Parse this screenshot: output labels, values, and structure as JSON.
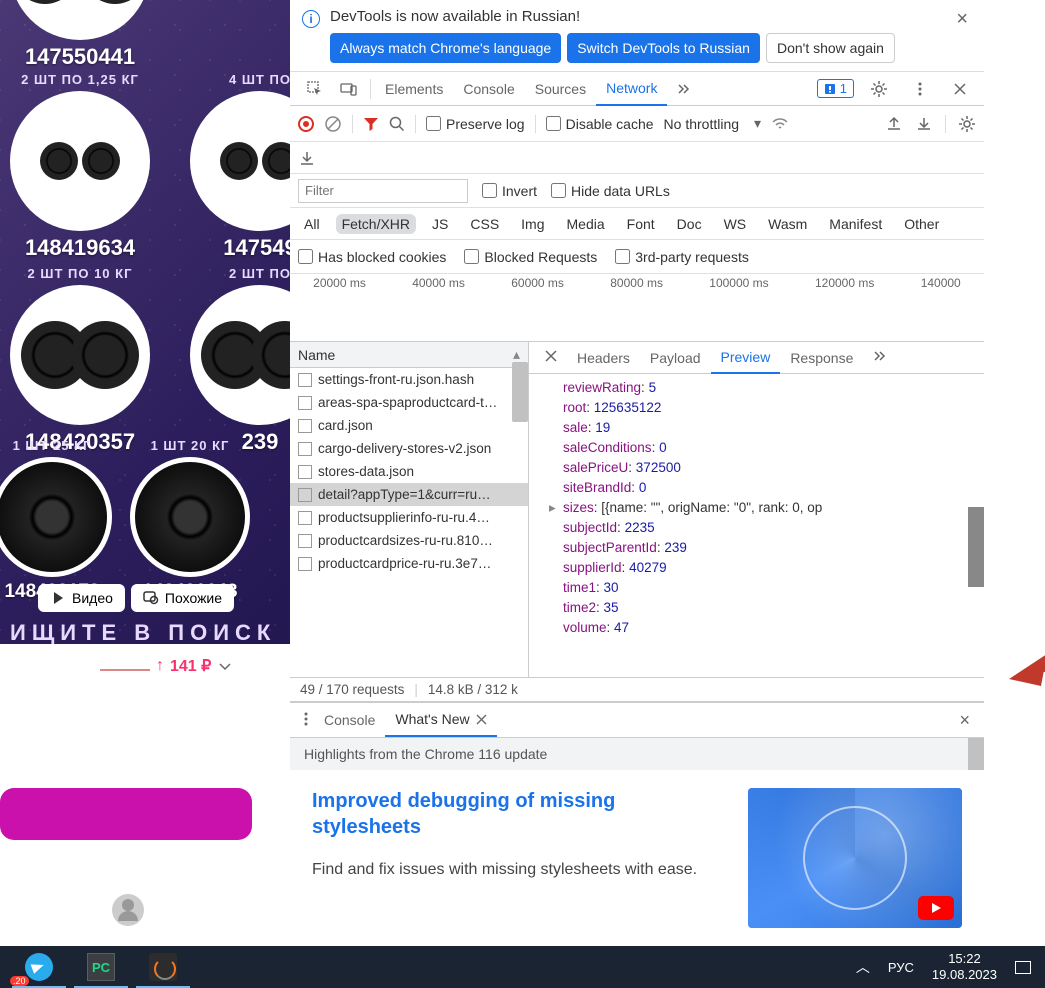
{
  "left": {
    "products": [
      {
        "arc": "",
        "num": "147550441"
      },
      {
        "arc": "2 ШТ ПО 1,25 КГ",
        "num": "148419634"
      },
      {
        "arc": "4 ШТ ПО",
        "num": "147549"
      },
      {
        "arc": "2 ШТ ПО 10 КГ",
        "num": "148420357"
      },
      {
        "arc": "2 ШТ ПО",
        "num": "239"
      },
      {
        "arc": "1 ШТ 25 КГ",
        "num": "148422178"
      },
      {
        "arc": "1 ШТ 20 КГ",
        "num": "148421643"
      }
    ],
    "video_btn": "Видео",
    "similar_btn": "Похожие",
    "search_text": "ИЩИТЕ В ПОИСК",
    "price": "141 ₽"
  },
  "infobar": {
    "text": "DevTools is now available in Russian!",
    "btn1": "Always match Chrome's language",
    "btn2": "Switch DevTools to Russian",
    "btn3": "Don't show again"
  },
  "tabs": {
    "elements": "Elements",
    "console": "Console",
    "sources": "Sources",
    "network": "Network",
    "issues": "1"
  },
  "toolbar": {
    "preserve": "Preserve log",
    "disable": "Disable cache",
    "throttle": "No throttling"
  },
  "filter": {
    "placeholder": "Filter",
    "invert": "Invert",
    "hide": "Hide data URLs"
  },
  "types": {
    "all": "All",
    "fetch": "Fetch/XHR",
    "js": "JS",
    "css": "CSS",
    "img": "Img",
    "media": "Media",
    "font": "Font",
    "doc": "Doc",
    "ws": "WS",
    "wasm": "Wasm",
    "manifest": "Manifest",
    "other": "Other"
  },
  "block": {
    "cookies": "Has blocked cookies",
    "requests": "Blocked Requests",
    "third": "3rd-party requests"
  },
  "timeline": [
    "20000 ms",
    "40000 ms",
    "60000 ms",
    "80000 ms",
    "100000 ms",
    "120000 ms",
    "140000"
  ],
  "reqs": {
    "header": "Name",
    "items": [
      "settings-front-ru.json.hash",
      "areas-spa-spaproductcard-t…",
      "card.json",
      "cargo-delivery-stores-v2.json",
      "stores-data.json",
      "detail?appType=1&curr=ru…",
      "productsupplierinfo-ru-ru.4…",
      "productcardsizes-ru-ru.810…",
      "productcardprice-ru-ru.3e7…"
    ],
    "selected": 5
  },
  "dtabs": {
    "headers": "Headers",
    "payload": "Payload",
    "preview": "Preview",
    "response": "Response"
  },
  "json": [
    {
      "k": "reviewRating",
      "v": "5",
      "t": "n"
    },
    {
      "k": "root",
      "v": "125635122",
      "t": "n"
    },
    {
      "k": "sale",
      "v": "19",
      "t": "n"
    },
    {
      "k": "saleConditions",
      "v": "0",
      "t": "n"
    },
    {
      "k": "salePriceU",
      "v": "372500",
      "t": "n"
    },
    {
      "k": "siteBrandId",
      "v": "0",
      "t": "n"
    },
    {
      "k": "sizes",
      "v": "[{name: \"\", origName: \"0\", rank: 0, op",
      "t": "arr"
    },
    {
      "k": "subjectId",
      "v": "2235",
      "t": "n"
    },
    {
      "k": "subjectParentId",
      "v": "239",
      "t": "n"
    },
    {
      "k": "supplierId",
      "v": "40279",
      "t": "n"
    },
    {
      "k": "time1",
      "v": "30",
      "t": "n"
    },
    {
      "k": "time2",
      "v": "35",
      "t": "n"
    },
    {
      "k": "volume",
      "v": "47",
      "t": "n"
    }
  ],
  "status": {
    "requests": "49 / 170 requests",
    "transfer": "14.8 kB / 312 k"
  },
  "drawer": {
    "console": "Console",
    "whatsnew": "What's New"
  },
  "whatsnew": {
    "highlights": "Highlights from the Chrome 116 update",
    "title": "Improved debugging of missing stylesheets",
    "desc": "Find and fix issues with missing stylesheets with ease."
  },
  "taskbar": {
    "lang": "РУС",
    "time": "15:22",
    "date": "19.08.2023",
    "badge": ".20"
  }
}
